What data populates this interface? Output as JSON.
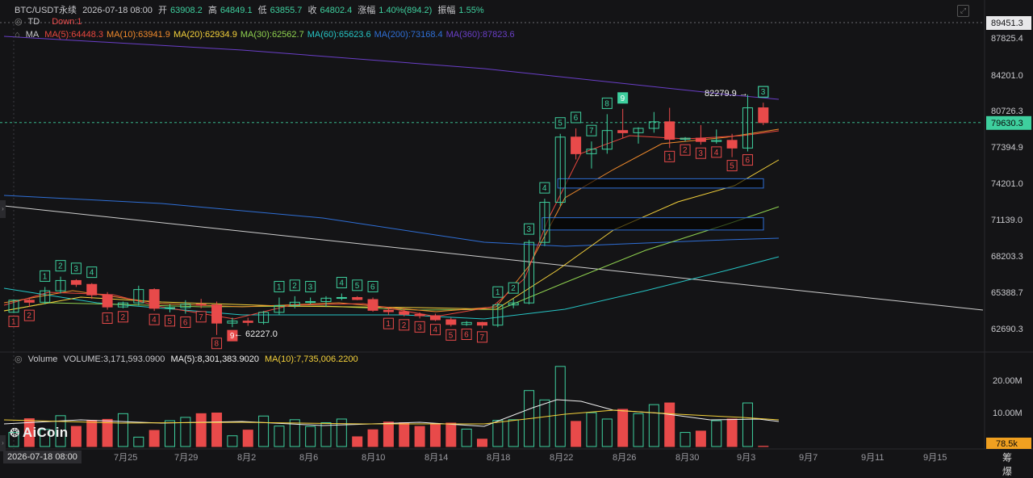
{
  "header": {
    "symbol": "BTC/USDT永续",
    "datetime": "2026-07-18 08:00",
    "open_label": "开",
    "open": "63908.2",
    "high_label": "高",
    "high": "64849.1",
    "low_label": "低",
    "low": "63855.7",
    "close_label": "收",
    "close": "64802.4",
    "change_label": "涨幅",
    "change": "1.40%(894.2)",
    "amp_label": "振幅",
    "amp": "1.55%",
    "td_label": "TD",
    "td_value": "Down:1",
    "ma_label": "MA",
    "ma_items": [
      {
        "text": "MA(5):64448.3",
        "color": "#e8473e"
      },
      {
        "text": "MA(10):63941.9",
        "color": "#f08a2c"
      },
      {
        "text": "MA(20):62934.9",
        "color": "#f5d23b"
      },
      {
        "text": "MA(30):62562.7",
        "color": "#8fd14f"
      },
      {
        "text": "MA(60):65623.6",
        "color": "#26c4c4"
      },
      {
        "text": "MA(200):73168.4",
        "color": "#2f6fd6"
      },
      {
        "text": "MA(360):87823.6",
        "color": "#6a3fc8"
      }
    ]
  },
  "volume_header": {
    "label": "Volume",
    "volume": "VOLUME:3,171,593.0900",
    "ma5": "MA(5):8,301,383.9020",
    "ma10": "MA(10):7,735,006.2200",
    "ma5_color": "#f0f0f0",
    "ma10_color": "#f5d23b"
  },
  "price_axis": {
    "ticks": [
      "87825.4",
      "84201.0",
      "80726.3",
      "77394.9",
      "74201.0",
      "71139.0",
      "68203.3",
      "65388.7",
      "62690.3"
    ],
    "top_tag": "89451.3",
    "current_tag": "79630.3",
    "current_value": 79630.3
  },
  "volume_axis": {
    "ticks": [
      "20.00M",
      "10.00M"
    ],
    "tag": "78.5k"
  },
  "date_axis": {
    "labels": [
      "7月25",
      "7月29",
      "8月2",
      "8月6",
      "8月10",
      "8月14",
      "8月18",
      "8月22",
      "8月26",
      "8月30",
      "9月3",
      "9月7",
      "9月11",
      "9月15"
    ],
    "cursor_date": "2026-07-18 08:00"
  },
  "annotations": {
    "low_marker": "62227.0",
    "high_marker": "82279.9"
  },
  "logo": "AiCoin",
  "footer_right": "筹 爆",
  "colors": {
    "up": "#3ecf9e",
    "down": "#e84a4a",
    "background": "#141416"
  },
  "chart_data": {
    "type": "candlestick",
    "x_range": [
      "2026-07-18",
      "2026-09-03"
    ],
    "ylim": [
      62000,
      89451.3
    ],
    "dates": [
      "07-18",
      "07-19",
      "07-20",
      "07-21",
      "07-22",
      "07-23",
      "07-24",
      "07-25",
      "07-26",
      "07-27",
      "07-28",
      "07-29",
      "07-30",
      "07-31",
      "08-01",
      "08-02",
      "08-03",
      "08-04",
      "08-05",
      "08-06",
      "08-07",
      "08-08",
      "08-09",
      "08-10",
      "08-11",
      "08-12",
      "08-13",
      "08-14",
      "08-15",
      "08-16",
      "08-17",
      "08-18",
      "08-19",
      "08-20",
      "08-21",
      "08-22",
      "08-23",
      "08-24",
      "08-25",
      "08-26",
      "08-27",
      "08-28",
      "08-29",
      "08-30",
      "08-31",
      "09-01",
      "09-02",
      "09-03",
      "09-04"
    ],
    "ohlc": [
      [
        63908.2,
        64849.1,
        63855.7,
        64802.4
      ],
      [
        64800,
        65000,
        64300,
        64650
      ],
      [
        64650,
        65800,
        64500,
        65500
      ],
      [
        65500,
        66600,
        65300,
        66300
      ],
      [
        66300,
        66400,
        65800,
        66000
      ],
      [
        66000,
        66100,
        64900,
        65200
      ],
      [
        65200,
        65400,
        64100,
        64300
      ],
      [
        64300,
        64700,
        64200,
        64600
      ],
      [
        64600,
        65900,
        64400,
        65600
      ],
      [
        65600,
        65700,
        64000,
        64200
      ],
      [
        64200,
        64500,
        63900,
        64250
      ],
      [
        64250,
        64800,
        63800,
        64500
      ],
      [
        64500,
        64900,
        64200,
        64450
      ],
      [
        64450,
        64700,
        62227,
        63100
      ],
      [
        63100,
        63500,
        62800,
        63250
      ],
      [
        63250,
        63500,
        62900,
        63150
      ],
      [
        63150,
        64000,
        63000,
        63900
      ],
      [
        63900,
        65000,
        63700,
        64400
      ],
      [
        64400,
        65100,
        64200,
        64650
      ],
      [
        64650,
        65000,
        64500,
        64700
      ],
      [
        64700,
        65100,
        64300,
        64950
      ],
      [
        64950,
        65300,
        64800,
        65000
      ],
      [
        65000,
        65100,
        64800,
        64850
      ],
      [
        64850,
        65000,
        63950,
        64050
      ],
      [
        64050,
        64300,
        63700,
        63950
      ],
      [
        63950,
        64200,
        63600,
        63750
      ],
      [
        63750,
        63900,
        63450,
        63650
      ],
      [
        63650,
        63800,
        63250,
        63350
      ],
      [
        63350,
        63500,
        62850,
        63000
      ],
      [
        63000,
        63250,
        62900,
        63150
      ],
      [
        63150,
        63200,
        62700,
        62950
      ],
      [
        62950,
        64600,
        62800,
        64450
      ],
      [
        64450,
        64900,
        64200,
        64600
      ],
      [
        64600,
        69500,
        64500,
        69300
      ],
      [
        69300,
        72900,
        69000,
        72600
      ],
      [
        72600,
        78600,
        72300,
        78300
      ],
      [
        78300,
        79100,
        76300,
        76800
      ],
      [
        76800,
        77900,
        75500,
        77200
      ],
      [
        77200,
        80400,
        76800,
        78900
      ],
      [
        78900,
        80900,
        78200,
        78700
      ],
      [
        78700,
        79200,
        77700,
        79100
      ],
      [
        79100,
        80600,
        78700,
        79700
      ],
      [
        79700,
        81000,
        77300,
        78100
      ],
      [
        78100,
        78300,
        77900,
        78200
      ],
      [
        78200,
        79400,
        77600,
        77900
      ],
      [
        77900,
        79000,
        77700,
        78000
      ],
      [
        78000,
        78600,
        76500,
        77300
      ],
      [
        77300,
        82279.9,
        77000,
        81000
      ],
      [
        81000,
        81500,
        79400,
        79630.3
      ]
    ],
    "td_labels": [
      {
        "i": 0,
        "pos": "below",
        "n": "1",
        "dir": "down"
      },
      {
        "i": 1,
        "pos": "below",
        "n": "2",
        "dir": "down"
      },
      {
        "i": 2,
        "pos": "above",
        "n": "1",
        "dir": "up"
      },
      {
        "i": 3,
        "pos": "above",
        "n": "2",
        "dir": "up"
      },
      {
        "i": 4,
        "pos": "above",
        "n": "3",
        "dir": "up"
      },
      {
        "i": 5,
        "pos": "above",
        "n": "4",
        "dir": "up"
      },
      {
        "i": 6,
        "pos": "below",
        "n": "1",
        "dir": "down"
      },
      {
        "i": 7,
        "pos": "below",
        "n": "2",
        "dir": "down"
      },
      {
        "i": 9,
        "pos": "below",
        "n": "4",
        "dir": "down"
      },
      {
        "i": 10,
        "pos": "below",
        "n": "5",
        "dir": "down"
      },
      {
        "i": 11,
        "pos": "below",
        "n": "6",
        "dir": "down"
      },
      {
        "i": 12,
        "pos": "below",
        "n": "7",
        "dir": "down"
      },
      {
        "i": 13,
        "pos": "below",
        "n": "8",
        "dir": "down"
      },
      {
        "i": 14,
        "pos": "below",
        "n": "9",
        "dir": "down",
        "filled": true
      },
      {
        "i": 17,
        "pos": "above",
        "n": "1",
        "dir": "up"
      },
      {
        "i": 18,
        "pos": "above",
        "n": "2",
        "dir": "up"
      },
      {
        "i": 19,
        "pos": "above",
        "n": "3",
        "dir": "up"
      },
      {
        "i": 21,
        "pos": "above",
        "n": "4",
        "dir": "up"
      },
      {
        "i": 22,
        "pos": "above",
        "n": "5",
        "dir": "up"
      },
      {
        "i": 23,
        "pos": "above",
        "n": "6",
        "dir": "up"
      },
      {
        "i": 24,
        "pos": "below",
        "n": "1",
        "dir": "down"
      },
      {
        "i": 25,
        "pos": "below",
        "n": "2",
        "dir": "down"
      },
      {
        "i": 26,
        "pos": "below",
        "n": "3",
        "dir": "down"
      },
      {
        "i": 27,
        "pos": "below",
        "n": "4",
        "dir": "down"
      },
      {
        "i": 28,
        "pos": "below",
        "n": "5",
        "dir": "down"
      },
      {
        "i": 29,
        "pos": "below",
        "n": "6",
        "dir": "down"
      },
      {
        "i": 30,
        "pos": "below",
        "n": "7",
        "dir": "down"
      },
      {
        "i": 31,
        "pos": "above",
        "n": "1",
        "dir": "up"
      },
      {
        "i": 32,
        "pos": "above",
        "n": "2",
        "dir": "up"
      },
      {
        "i": 33,
        "pos": "above",
        "n": "3",
        "dir": "up"
      },
      {
        "i": 34,
        "pos": "above",
        "n": "4",
        "dir": "up"
      },
      {
        "i": 35,
        "pos": "above",
        "n": "5",
        "dir": "up"
      },
      {
        "i": 36,
        "pos": "above",
        "n": "6",
        "dir": "up"
      },
      {
        "i": 37,
        "pos": "above",
        "n": "7",
        "dir": "up"
      },
      {
        "i": 38,
        "pos": "above",
        "n": "8",
        "dir": "up"
      },
      {
        "i": 39,
        "pos": "above",
        "n": "9",
        "dir": "up",
        "filled": true
      },
      {
        "i": 42,
        "pos": "below",
        "n": "1",
        "dir": "down"
      },
      {
        "i": 43,
        "pos": "below",
        "n": "2",
        "dir": "down"
      },
      {
        "i": 44,
        "pos": "below",
        "n": "3",
        "dir": "down"
      },
      {
        "i": 45,
        "pos": "below",
        "n": "4",
        "dir": "down"
      },
      {
        "i": 46,
        "pos": "below",
        "n": "5",
        "dir": "down"
      },
      {
        "i": 47,
        "pos": "below",
        "n": "6",
        "dir": "down"
      },
      {
        "i": 48,
        "pos": "above",
        "n": "1",
        "dir": "up"
      },
      {
        "i": 49,
        "pos": "above",
        "n": "2",
        "dir": "up"
      },
      {
        "i": 50,
        "pos": "above",
        "n": "3",
        "dir": "up"
      }
    ],
    "volume_millions": [
      4.2,
      8.3,
      5.1,
      9.2,
      6.0,
      7.8,
      8.1,
      9.8,
      2.8,
      4.8,
      7.7,
      8.7,
      9.8,
      10.0,
      3.2,
      4.9,
      9.1,
      6.1,
      8.0,
      6.0,
      7.1,
      8.2,
      2.9,
      5.0,
      7.3,
      7.1,
      6.0,
      6.8,
      7.0,
      5.2,
      2.2,
      7.8,
      8.0,
      16.7,
      13.9,
      23.9,
      7.5,
      10.1,
      8.2,
      11.1,
      9.8,
      12.5,
      13.0,
      4.2,
      4.6,
      7.7,
      8.2,
      13.0,
      0.08
    ],
    "zones": [
      {
        "from": 73800,
        "to": 74600,
        "start_i": 35
      },
      {
        "from": 70300,
        "to": 71300,
        "start_i": 34
      }
    ]
  }
}
